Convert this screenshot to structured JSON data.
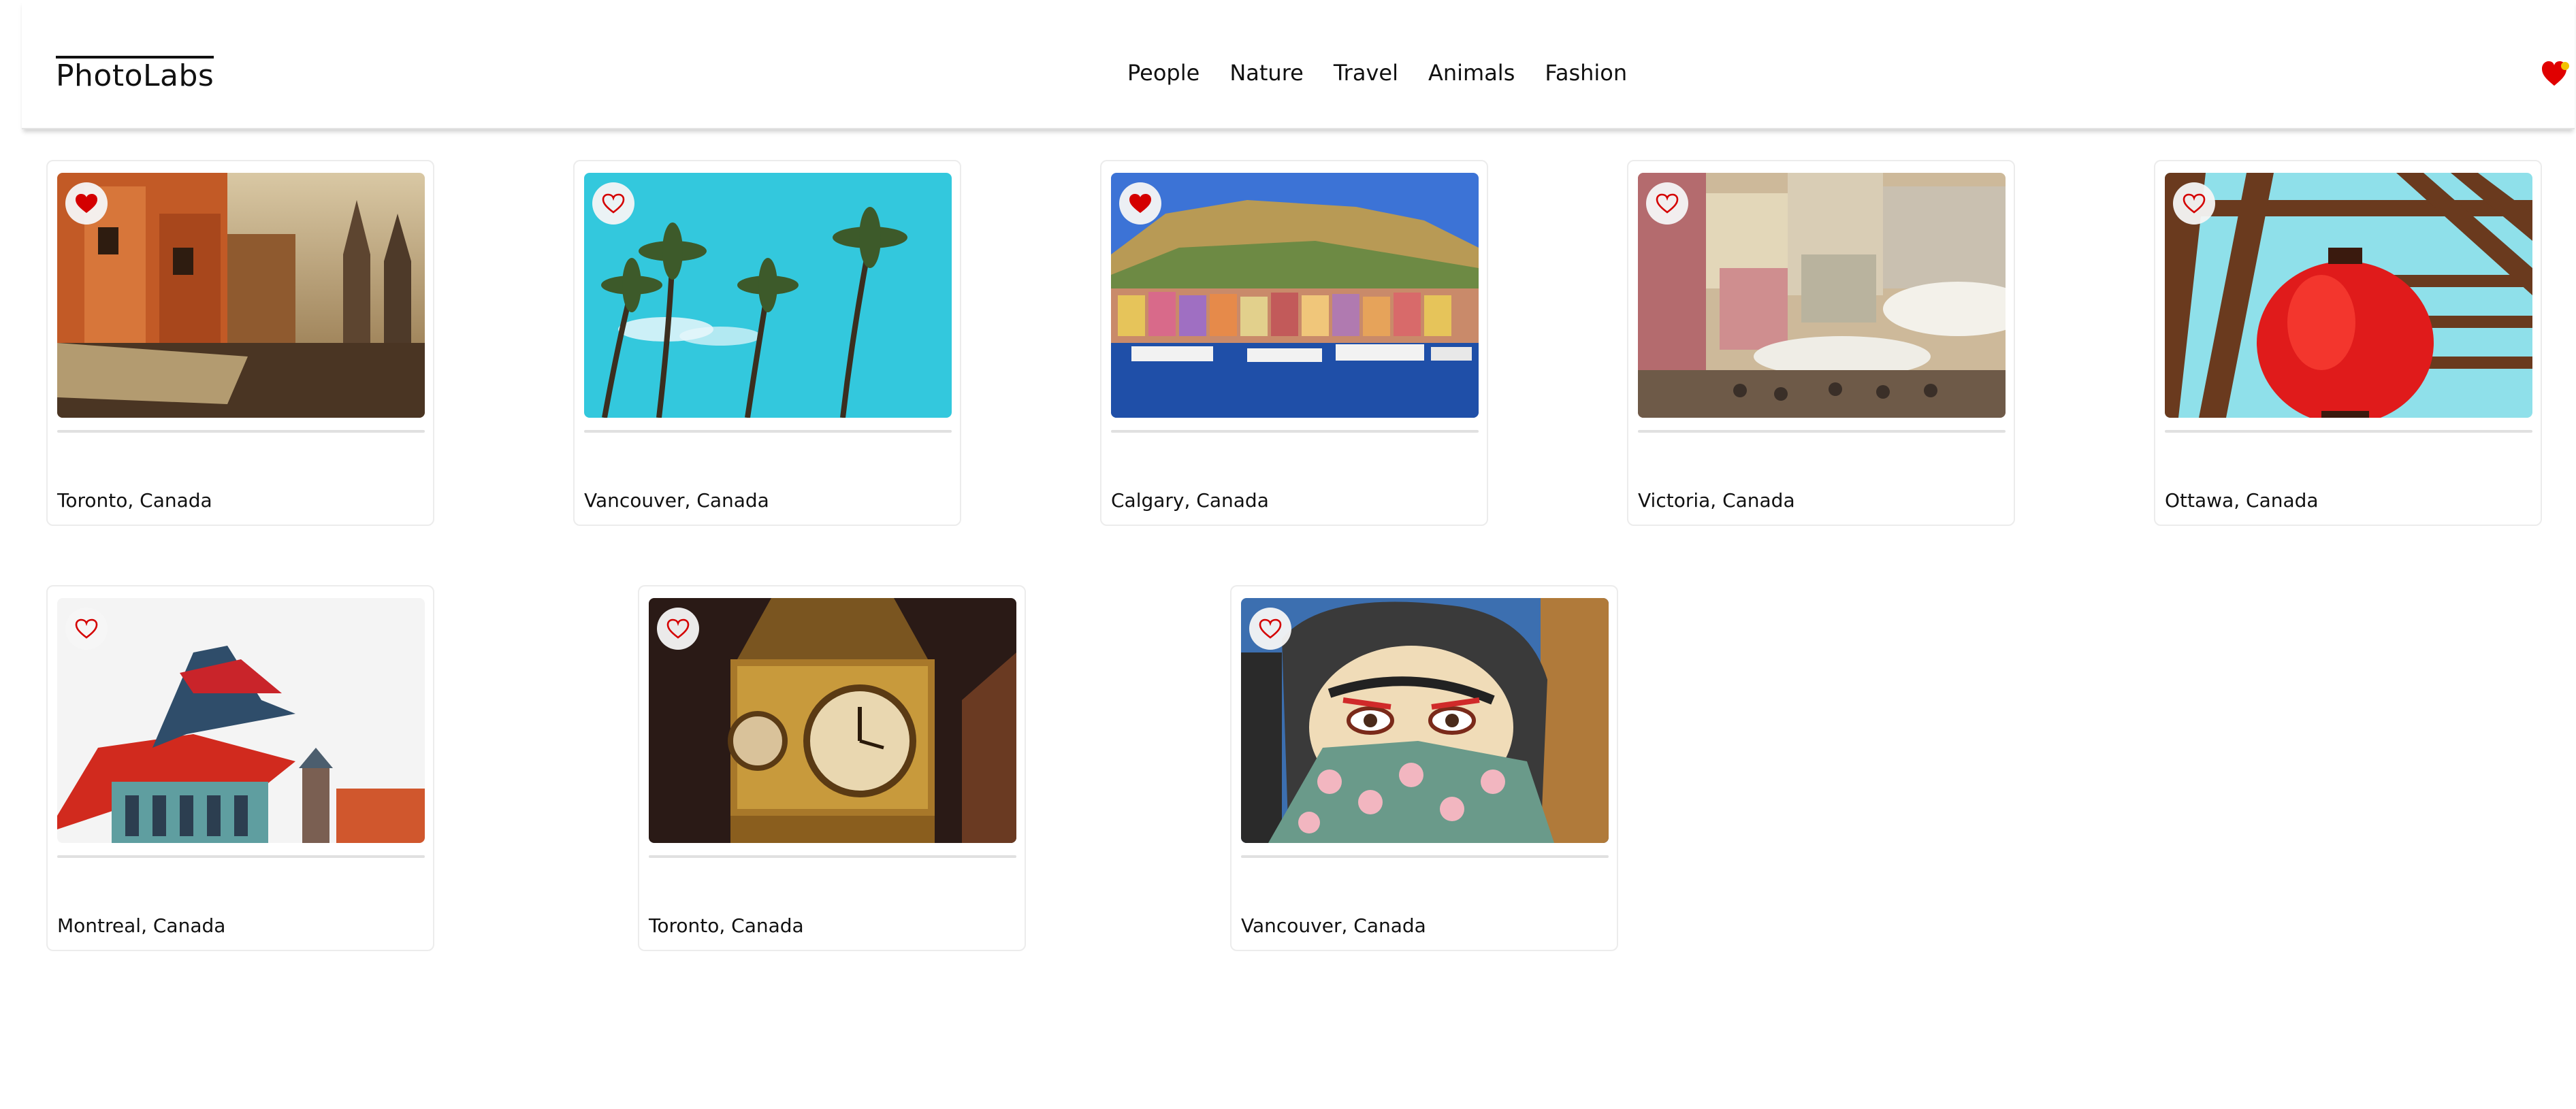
{
  "app": {
    "title": "PhotoLabs"
  },
  "nav": {
    "topics": [
      "People",
      "Nature",
      "Travel",
      "Animals",
      "Fashion"
    ],
    "fav_badge_icon": "heart-icon",
    "fav_badge_color": "#e00000",
    "fav_badge_alert_color": "#f2c200"
  },
  "photos": [
    {
      "location": "Toronto, Canada",
      "favorited": true,
      "image": "old-town-street-sunset"
    },
    {
      "location": "Vancouver, Canada",
      "favorited": false,
      "image": "palm-trees-blue-sky"
    },
    {
      "location": "Calgary, Canada",
      "favorited": true,
      "image": "colorful-harbor-town"
    },
    {
      "location": "Victoria, Canada",
      "favorited": false,
      "image": "hillside-market-umbrellas"
    },
    {
      "location": "Ottawa, Canada",
      "favorited": false,
      "image": "red-paper-lantern-pergola"
    },
    {
      "location": "Montreal, Canada",
      "favorited": false,
      "image": "red-pagoda-roof"
    },
    {
      "location": "Toronto, Canada",
      "favorited": false,
      "image": "clock-tower-night"
    },
    {
      "location": "Vancouver, Canada",
      "favorited": false,
      "image": "geisha-mural"
    }
  ],
  "colors": {
    "favorite": "#d40000",
    "card_border": "#ececec"
  }
}
